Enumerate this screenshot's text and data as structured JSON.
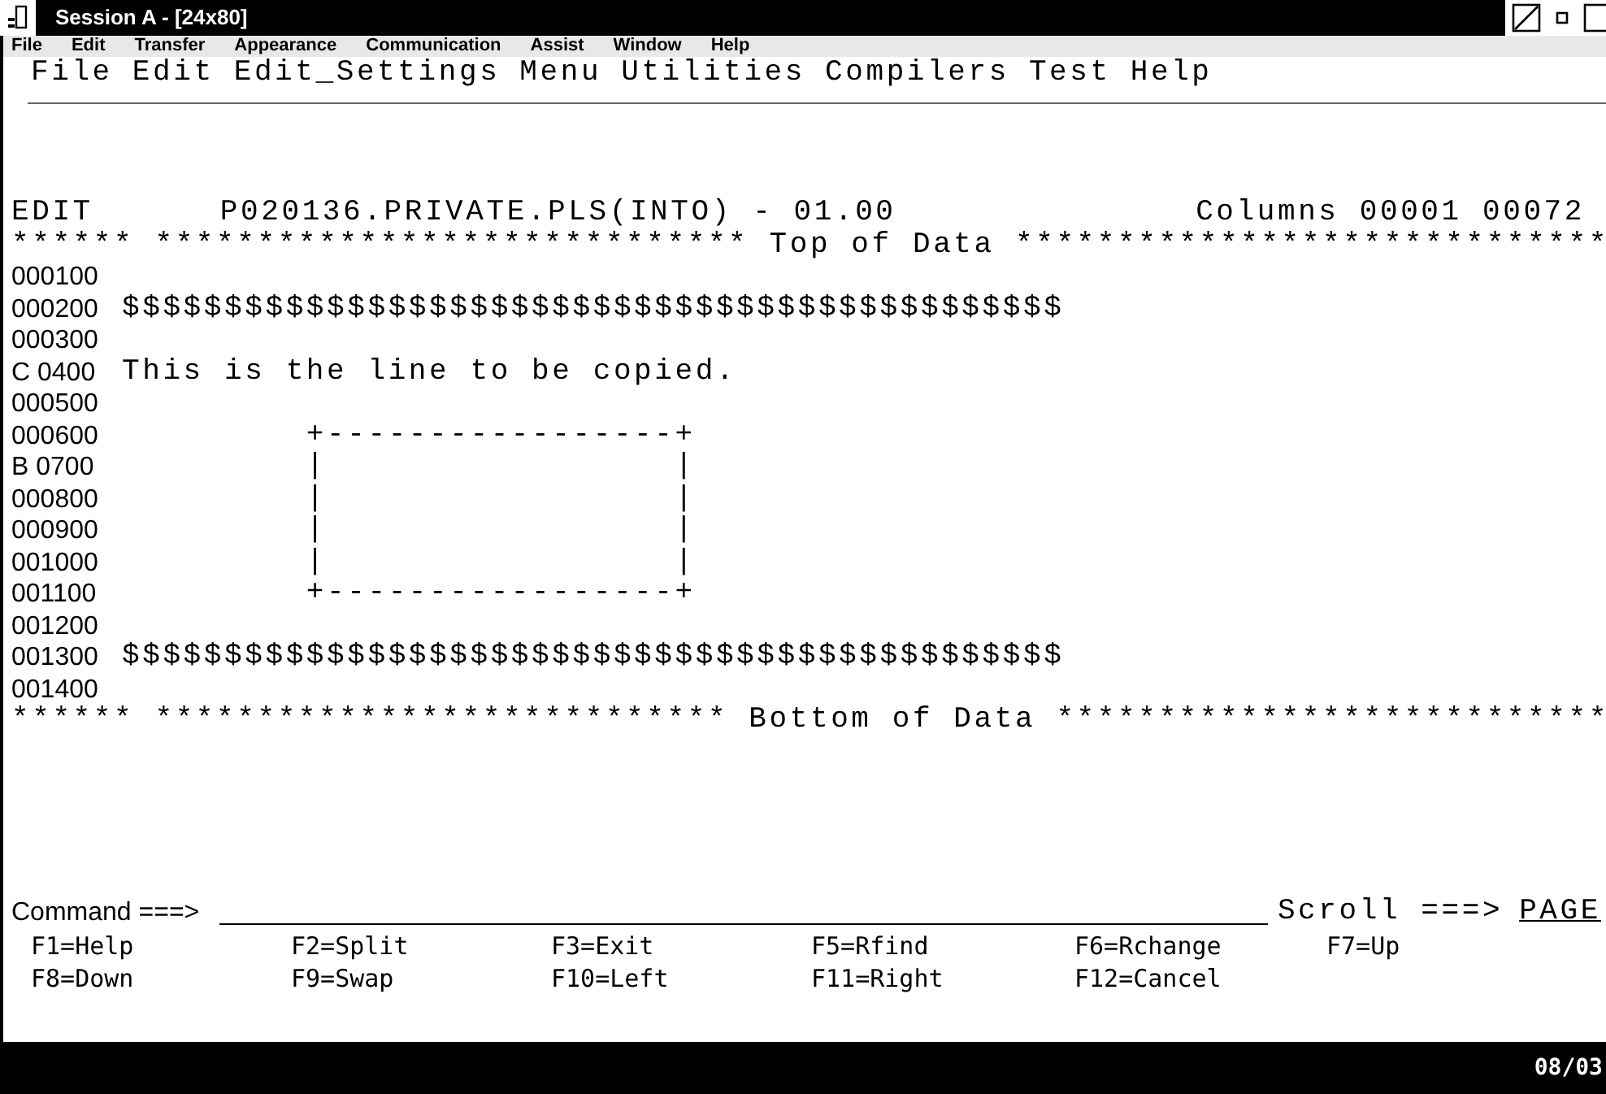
{
  "window": {
    "title": "Session A - [24x80]"
  },
  "menu_bar": [
    "File",
    "Edit",
    "Transfer",
    "Appearance",
    "Communication",
    "Assist",
    "Window",
    "Help"
  ],
  "ispf_menu": [
    "File",
    "Edit",
    "Edit_Settings",
    "Menu",
    "Utilities",
    "Compilers",
    "Test",
    "Help"
  ],
  "header": {
    "mode": "EDIT",
    "dataset": "P020136.PRIVATE.PLS(INTO) - 01.00",
    "columns": "Columns 00001 00072"
  },
  "top_marker": "****** ***************************** Top of Data *****************************",
  "lines": [
    {
      "number": "000100"
    },
    {
      "number": "000200",
      "text": "$$$$$$$$$$$$$$$$$$$$$$$$$$$$$$$$$$$$$$$$$$$$$$"
    },
    {
      "number": "000300"
    },
    {
      "number": "C 0400",
      "text": "This is the line to be copied."
    },
    {
      "number": "000500"
    },
    {
      "number": "000600",
      "text": "         +-----------------+"
    },
    {
      "number": "B 0700",
      "text": "         |                 |"
    },
    {
      "number": "000800",
      "text": "         |                 |"
    },
    {
      "number": "000900",
      "text": "         |                 |"
    },
    {
      "number": "001000",
      "text": "         |                 |"
    },
    {
      "number": "001100",
      "text": "         +-----------------+"
    },
    {
      "number": "001200"
    },
    {
      "number": "001300",
      "text": "$$$$$$$$$$$$$$$$$$$$$$$$$$$$$$$$$$$$$$$$$$$$$$"
    },
    {
      "number": "001400"
    }
  ],
  "bottom_marker": "****** **************************** Bottom of Data ***************************",
  "command": {
    "label": "Command ===>",
    "scroll_label": "Scroll ===>",
    "scroll_value": "PAGE"
  },
  "function_keys": [
    [
      "F1=Help",
      "F2=Split",
      "F3=Exit",
      "F5=Rfind",
      "F6=Rchange",
      "F7=Up"
    ],
    [
      "F8=Down",
      "F9=Swap",
      "F10=Left",
      "F11=Right",
      "F12=Cancel"
    ]
  ],
  "status_bar": {
    "cursor": "08/03"
  }
}
